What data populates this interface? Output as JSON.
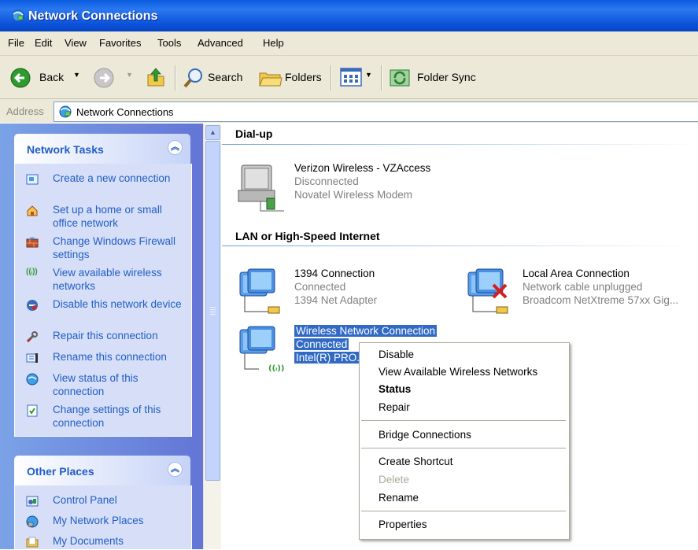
{
  "window": {
    "title": "Network Connections"
  },
  "menu": [
    "File",
    "Edit",
    "View",
    "Favorites",
    "Tools",
    "Advanced",
    "Help"
  ],
  "toolbar": {
    "back": "Back",
    "search": "Search",
    "folders": "Folders",
    "folder_sync": "Folder Sync"
  },
  "address": {
    "label": "Address",
    "value": "Network Connections"
  },
  "network_tasks": {
    "title": "Network Tasks",
    "items": [
      {
        "label": "Create a new connection",
        "icon": "new-connection-icon"
      },
      {
        "label": "Set up a home or small office network",
        "icon": "home-network-icon"
      },
      {
        "label": "Change Windows Firewall settings",
        "icon": "firewall-icon"
      },
      {
        "label": "View available wireless networks",
        "icon": "wireless-icon"
      },
      {
        "label": "Disable this network device",
        "icon": "disable-icon"
      },
      {
        "label": "Repair this connection",
        "icon": "repair-icon"
      },
      {
        "label": "Rename this connection",
        "icon": "rename-icon"
      },
      {
        "label": "View status of this connection",
        "icon": "status-icon"
      },
      {
        "label": "Change settings of this connection",
        "icon": "settings-icon"
      }
    ]
  },
  "other_places": {
    "title": "Other Places",
    "items": [
      {
        "label": "Control Panel",
        "icon": "control-panel-icon"
      },
      {
        "label": "My Network Places",
        "icon": "network-places-icon"
      },
      {
        "label": "My Documents",
        "icon": "documents-icon"
      }
    ]
  },
  "groups": {
    "dialup": {
      "header": "Dial-up",
      "connections": [
        {
          "name": "Verizon Wireless - VZAccess",
          "status": "Disconnected",
          "device": "Novatel Wireless Modem"
        }
      ]
    },
    "lan": {
      "header": "LAN or High-Speed Internet",
      "connections": [
        {
          "name": "1394 Connection",
          "status": "Connected",
          "device": "1394 Net Adapter"
        },
        {
          "name": "Local Area Connection",
          "status": "Network cable unplugged",
          "device": "Broadcom NetXtreme 57xx Gig..."
        },
        {
          "name": "Wireless Network Connection",
          "status": "Connected",
          "device": "Intel(R) PRO..."
        }
      ]
    }
  },
  "context_menu": {
    "items": [
      "Disable",
      "View Available Wireless Networks",
      "Status",
      "Repair",
      "Bridge Connections",
      "Create Shortcut",
      "Delete",
      "Rename",
      "Properties"
    ],
    "default_item": "Status",
    "disabled_item": "Delete"
  },
  "colors": {
    "title_bar": "#0a5ce0",
    "selection": "#316ac5",
    "task_link": "#215dc6",
    "left_pane": "#7ba2e7"
  }
}
